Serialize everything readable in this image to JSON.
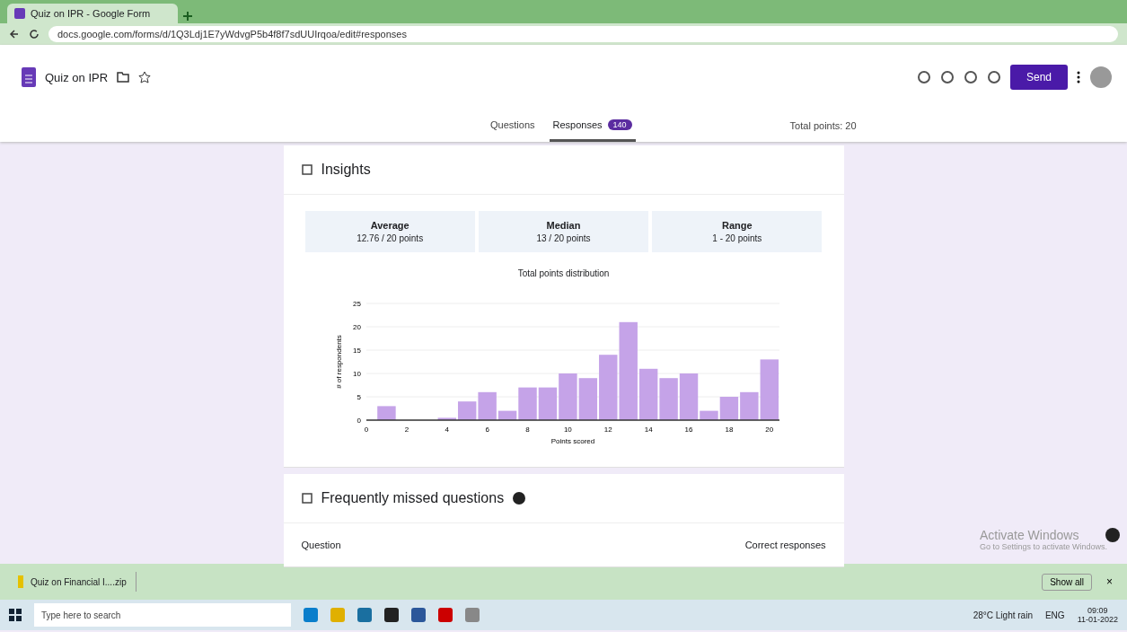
{
  "browser": {
    "tab_title": "Quiz on IPR - Google Form",
    "url": "docs.google.com/forms/d/1Q3Ldj1E7yWdvgP5b4f8f7sdUUIrqoa/edit#responses"
  },
  "form": {
    "title": "Quiz on IPR",
    "send": "Send",
    "tabs": [
      {
        "label": "Questions",
        "selected": false
      },
      {
        "label": "Responses",
        "selected": true,
        "badge": "140"
      }
    ],
    "total_points": "Total points: 20"
  },
  "insights": {
    "title": "Insights",
    "stats": [
      {
        "label": "Average",
        "value": "12.76 / 20 points"
      },
      {
        "label": "Median",
        "value": "13 / 20 points"
      },
      {
        "label": "Range",
        "value": "1 - 20 points"
      }
    ],
    "chart_data": {
      "type": "bar",
      "title": "Total points distribution",
      "xlabel": "Points scored",
      "ylabel": "# of respondents",
      "x": [
        1,
        2,
        3,
        4,
        5,
        6,
        7,
        8,
        9,
        10,
        11,
        12,
        13,
        14,
        15,
        16,
        17,
        18,
        19,
        20
      ],
      "grid": true,
      "series": [
        {
          "color": "#c5a3e8",
          "values": [
            3,
            0,
            0,
            0.5,
            4,
            6,
            2,
            7,
            7,
            10,
            9,
            14,
            21,
            11,
            9,
            10,
            2,
            5,
            6,
            13
          ]
        }
      ],
      "xlim": [
        0,
        20.5
      ],
      "ylim": [
        0,
        25
      ],
      "xticks": [
        0,
        2,
        4,
        6,
        8,
        10,
        12,
        14,
        16,
        18,
        20
      ],
      "yticks": [
        0,
        5,
        10,
        15,
        20,
        25
      ]
    }
  },
  "missed": {
    "title": "Frequently missed questions",
    "columns": [
      "Question",
      "Correct responses"
    ]
  },
  "os_notice": {
    "title": "Activate Windows",
    "text": "Go to Settings to activate Windows."
  },
  "downloads": {
    "file": "Quiz on Financial I....zip",
    "show_all": "Show all",
    "close": "×"
  },
  "taskbar": {
    "search_placeholder": "Type here to search",
    "weather": "28°C Light rain",
    "language": "ENG",
    "time": "09:09",
    "date": "11-01-2022"
  }
}
